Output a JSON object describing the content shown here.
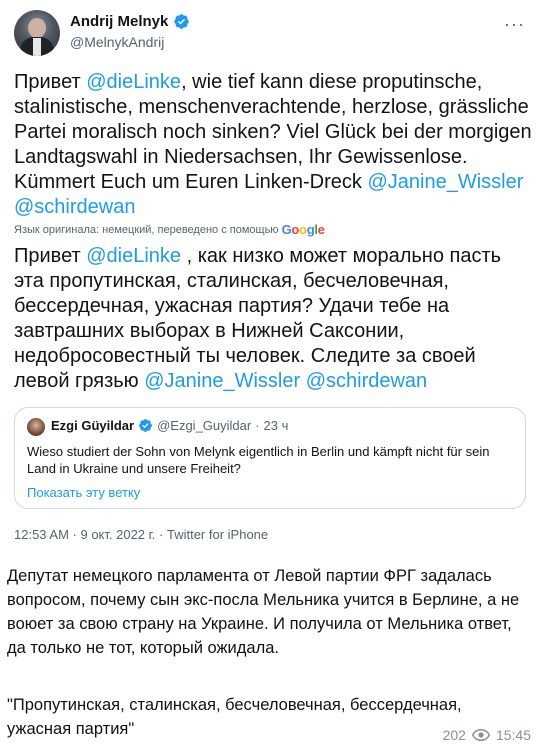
{
  "tweet": {
    "author_name": "Andrij Melnyk",
    "author_handle": "@MelnykAndrij",
    "more_glyph": "···",
    "text_parts": {
      "p1": "Привет ",
      "mention1": "@dieLinke",
      "p2": ", wie tief kann diese proputinsche, stalinistische, menschenverachtende, herzlose, grässliche Partei moralisch noch sinken? Viel Glück bei der morgigen Landtagswahl in Niedersachsen, Ihr Gewissenlose. Kümmert Euch um Euren Linken-Dreck ",
      "mention2": "@Janine_Wissler",
      "p3": " ",
      "mention3": "@schirdewan"
    },
    "translate_note": "Язык оригинала: немецкий, переведено с помощью",
    "google_letters": [
      "G",
      "o",
      "o",
      "g",
      "l",
      "e"
    ],
    "translated_parts": {
      "p1": "Привет ",
      "mention1": "@dieLinke",
      "p2": " , как низко может морально пасть эта пропутинская, сталинская, бесчеловечная, бессердечная, ужасная партия? Удачи тебе на завтрашних выборах в Нижней Саксонии, недобросовестный ты человек. Следите за своей левой грязью ",
      "mention2": "@Janine_Wissler",
      "p3": " ",
      "mention3": "@schirdewan"
    },
    "quoted": {
      "name": "Ezgi Güyildar",
      "handle": "@Ezgi_Guyildar",
      "separator": "·",
      "time": "23 ч",
      "text": "Wieso studiert der Sohn von Melynk eigentlich in Berlin und kämpft nicht für sein Land in Ukraine und unsere Freiheit?",
      "show_thread": "Показать эту ветку"
    },
    "meta": "12:53 AM · 9 окт. 2022 г. · Twitter for iPhone"
  },
  "post": {
    "text": "Депутат немецкого парламента от Левой партии ФРГ задалась вопросом, почему сын экс-посла Мельника учится в Берлине, а не воюет за свою страну на Украине. И получила от Мельника ответ, да только не тот, который ожидала.",
    "quote": "\"Пропутинская, сталинская, бесчеловечная, бессердечная, ужасная партия\"",
    "views": "202",
    "time": "15:45"
  },
  "colors": {
    "link": "#1d9bf0",
    "verified": "#1d9bf0",
    "secondary": "#536471"
  }
}
